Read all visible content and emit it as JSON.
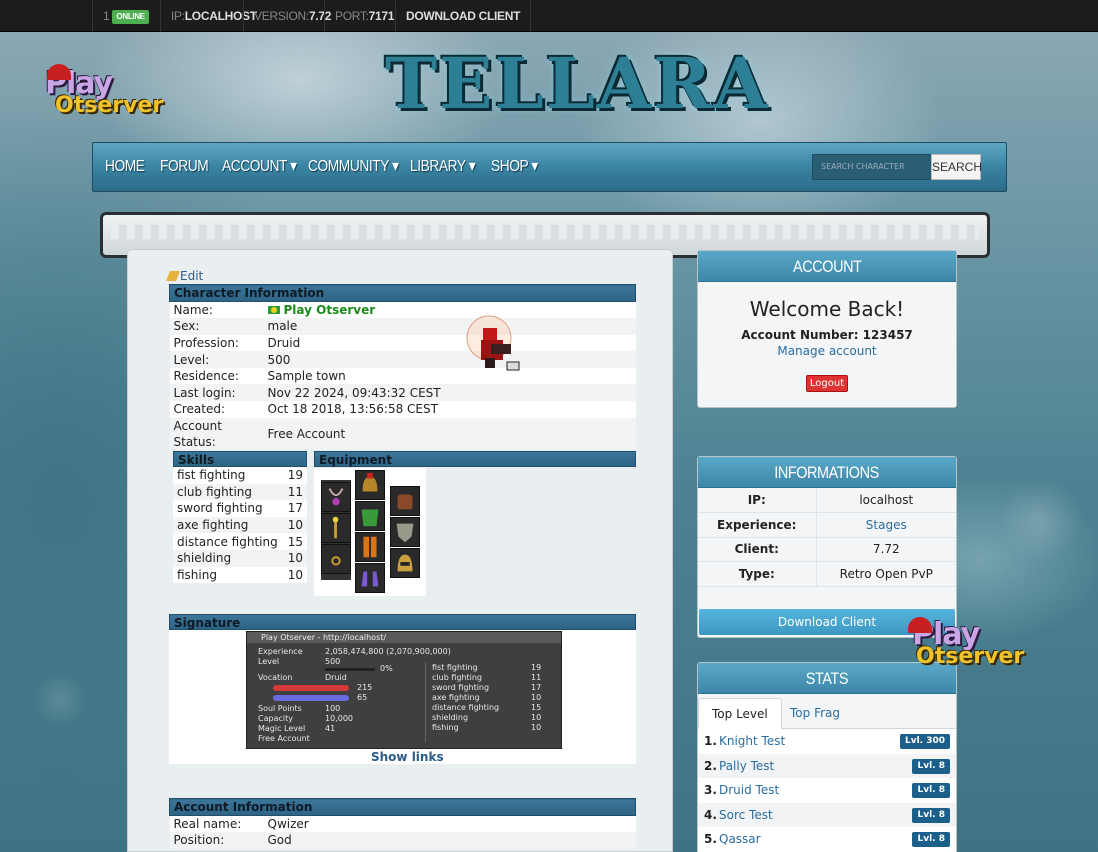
{
  "topbar": {
    "online_count": "1",
    "online_label": "ONLINE",
    "ip_label": "IP:",
    "ip_value": "LOCALHOST",
    "version_label": "VERSION:",
    "version_value": "7.72",
    "port_label": "PORT:",
    "port_value": "7171",
    "download": "DOWNLOAD CLIENT"
  },
  "logo": {
    "play_text": "Play",
    "otserver_text": "Otserver",
    "site_title": "TELLARA"
  },
  "nav": {
    "items": [
      "HOME",
      "FORUM",
      "ACCOUNT ▾",
      "COMMUNITY ▾",
      "LIBRARY ▾",
      "SHOP ▾"
    ],
    "search_placeholder": "SEARCH CHARACTER",
    "search_button": "SEARCH"
  },
  "character": {
    "edit_label": "Edit",
    "section_title": "Character Information",
    "rows": [
      {
        "label": "Name:",
        "value": "Play Otserver"
      },
      {
        "label": "Sex:",
        "value": "male"
      },
      {
        "label": "Profession:",
        "value": "Druid"
      },
      {
        "label": "Level:",
        "value": "500"
      },
      {
        "label": "Residence:",
        "value": "Sample town"
      },
      {
        "label": "Last login:",
        "value": "Nov 22 2024, 09:43:32 CEST"
      },
      {
        "label": "Created:",
        "value": "Oct 18 2018, 13:56:58 CEST"
      },
      {
        "label": "Account Status:",
        "value": "Free Account"
      }
    ]
  },
  "skills": {
    "title": "Skills",
    "rows": [
      {
        "name": "fist fighting",
        "value": "19"
      },
      {
        "name": "club fighting",
        "value": "11"
      },
      {
        "name": "sword fighting",
        "value": "17"
      },
      {
        "name": "axe fighting",
        "value": "10"
      },
      {
        "name": "distance fighting",
        "value": "15"
      },
      {
        "name": "shielding",
        "value": "10"
      },
      {
        "name": "fishing",
        "value": "10"
      }
    ]
  },
  "equipment": {
    "title": "Equipment"
  },
  "signature": {
    "title": "Signature",
    "window_title": "Play Otserver - http://localhost/",
    "experience_label": "Experience",
    "experience_value": "2,058,474,800 (2,070,900,000)",
    "level_label": "Level",
    "level_value": "500",
    "level_pct": "0%",
    "vocation_label": "Vocation",
    "vocation_value": "Druid",
    "hp_value": "215",
    "mana_value": "65",
    "soul_label": "Soul Points",
    "soul_value": "100",
    "capacity_label": "Capacity",
    "capacity_value": "10,000",
    "magic_label": "Magic Level",
    "magic_value": "41",
    "account_label": "Free Account",
    "skills": [
      {
        "name": "fist fighting",
        "value": "19"
      },
      {
        "name": "club fighting",
        "value": "11"
      },
      {
        "name": "sword fighting",
        "value": "17"
      },
      {
        "name": "axe fighting",
        "value": "10"
      },
      {
        "name": "distance fighting",
        "value": "15"
      },
      {
        "name": "shielding",
        "value": "10"
      },
      {
        "name": "fishing",
        "value": "10"
      }
    ],
    "show_links": "Show links"
  },
  "account_info": {
    "title": "Account Information",
    "rows": [
      {
        "label": "Real name:",
        "value": "Qwizer"
      },
      {
        "label": "Position:",
        "value": "God"
      }
    ]
  },
  "account_box": {
    "title": "ACCOUNT",
    "welcome": "Welcome Back!",
    "account_number": "Account Number: 123457",
    "manage": "Manage account",
    "logout": "Logout"
  },
  "info_box": {
    "title": "INFORMATIONS",
    "rows": [
      {
        "label": "IP:",
        "value": "localhost"
      },
      {
        "label": "Experience:",
        "value": "Stages"
      },
      {
        "label": "Client:",
        "value": "7.72"
      },
      {
        "label": "Type:",
        "value": "Retro Open PvP"
      }
    ],
    "download": "Download Client"
  },
  "stats_box": {
    "title": "STATS",
    "tabs": [
      "Top Level",
      "Top Frag"
    ],
    "ranks": [
      {
        "num": "1.",
        "name": "Knight Test",
        "level": "Lvl. 300"
      },
      {
        "num": "2.",
        "name": "Pally Test",
        "level": "Lvl. 8"
      },
      {
        "num": "3.",
        "name": "Druid Test",
        "level": "Lvl. 8"
      },
      {
        "num": "4.",
        "name": "Sorc Test",
        "level": "Lvl. 8"
      },
      {
        "num": "5.",
        "name": "Qassar",
        "level": "Lvl. 8"
      }
    ]
  }
}
